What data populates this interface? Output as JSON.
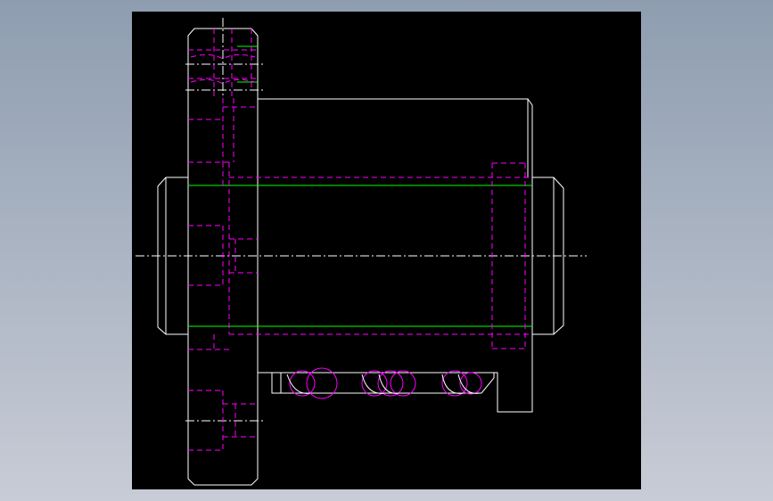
{
  "viewport": {
    "background_top": "#8e9db0",
    "background_bottom": "#c8ccd6"
  },
  "canvas": {
    "background": "#000000"
  },
  "colors": {
    "outline": "#ffffff",
    "hidden_line": "#ff00ff",
    "thread_line": "#00ff00",
    "center_line": "#ffffff"
  }
}
